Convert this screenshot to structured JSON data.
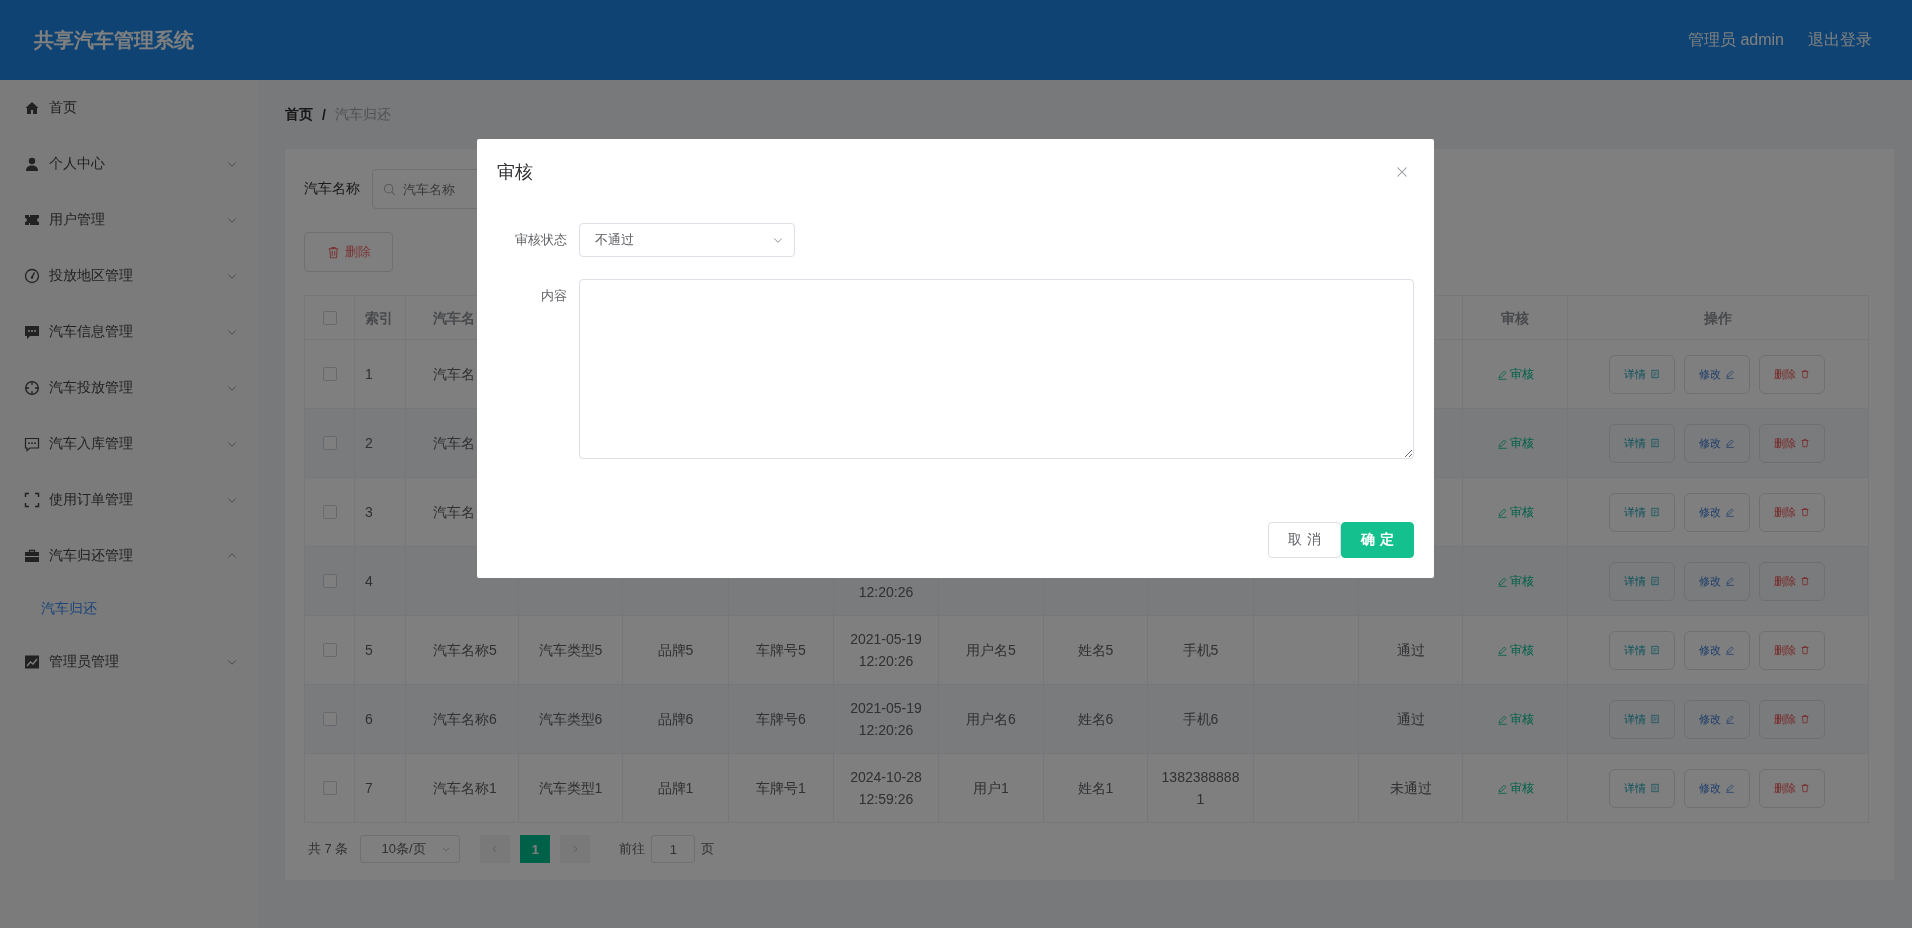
{
  "header": {
    "title": "共享汽车管理系统",
    "user": "管理员 admin",
    "logout": "退出登录"
  },
  "sidebar": {
    "items": [
      {
        "label": "首页",
        "selected": false
      },
      {
        "label": "个人中心",
        "selected": false,
        "expanded": false
      },
      {
        "label": "用户管理",
        "selected": false,
        "expanded": false
      },
      {
        "label": "投放地区管理",
        "selected": false,
        "expanded": false
      },
      {
        "label": "汽车信息管理",
        "selected": false,
        "expanded": false
      },
      {
        "label": "汽车投放管理",
        "selected": false,
        "expanded": false
      },
      {
        "label": "汽车入库管理",
        "selected": false,
        "expanded": false
      },
      {
        "label": "使用订单管理",
        "selected": false,
        "expanded": false
      },
      {
        "label": "汽车归还管理",
        "selected": false,
        "expanded": true,
        "children": [
          {
            "label": "汽车归还",
            "selected": true
          }
        ]
      },
      {
        "label": "管理员管理",
        "selected": false,
        "expanded": false
      }
    ]
  },
  "breadcrumb": {
    "separator": "/",
    "items": [
      {
        "label": "首页",
        "selected": false
      },
      {
        "label": "汽车归还",
        "selected": true
      }
    ]
  },
  "search": {
    "label": "汽车名称",
    "placeholder": "汽车名称"
  },
  "delete_button": "删除",
  "table": {
    "select_all": {
      "checked": false
    },
    "columns": [
      {
        "kind": "index",
        "label": "索引"
      },
      {
        "kind": "name",
        "label": "汽车名"
      },
      {
        "kind": "review",
        "label": "审核"
      },
      {
        "kind": "actions",
        "label": "操作"
      }
    ],
    "rows": [
      {
        "checked": false,
        "index": "1",
        "name": "汽车名",
        "review": "审核",
        "actions": [
          {
            "kind": "detail",
            "label": "详情"
          },
          {
            "kind": "edit",
            "label": "修改"
          },
          {
            "kind": "delete",
            "label": "删除"
          }
        ]
      },
      {
        "checked": false,
        "index": "2",
        "name": "汽车名",
        "review": "审核",
        "actions": [
          {
            "kind": "detail",
            "label": "详情"
          },
          {
            "kind": "edit",
            "label": "修改"
          },
          {
            "kind": "delete",
            "label": "删除"
          }
        ]
      },
      {
        "checked": false,
        "index": "3",
        "name": "汽车名",
        "review": "审核",
        "actions": [
          {
            "kind": "detail",
            "label": "详情"
          },
          {
            "kind": "edit",
            "label": "修改"
          },
          {
            "kind": "delete",
            "label": "删除"
          }
        ]
      },
      {
        "checked": false,
        "index": "4",
        "time": "12:20:26",
        "review": "审核",
        "actions": [
          {
            "kind": "detail",
            "label": "详情"
          },
          {
            "kind": "edit",
            "label": "修改"
          },
          {
            "kind": "delete",
            "label": "删除"
          }
        ]
      },
      {
        "checked": false,
        "index": "5",
        "name": "汽车名称5",
        "type": "汽车类型5",
        "brand": "品牌5",
        "plate": "车牌号5",
        "time": "2021-05-19 12:20:26",
        "user": "用户名5",
        "realname": "姓名5",
        "phone": "手机5",
        "status": "通过",
        "review": "审核",
        "actions": [
          {
            "kind": "detail",
            "label": "详情"
          },
          {
            "kind": "edit",
            "label": "修改"
          },
          {
            "kind": "delete",
            "label": "删除"
          }
        ]
      },
      {
        "checked": false,
        "index": "6",
        "name": "汽车名称6",
        "type": "汽车类型6",
        "brand": "品牌6",
        "plate": "车牌号6",
        "time": "2021-05-19 12:20:26",
        "user": "用户名6",
        "realname": "姓名6",
        "phone": "手机6",
        "status": "通过",
        "review": "审核",
        "actions": [
          {
            "kind": "detail",
            "label": "详情"
          },
          {
            "kind": "edit",
            "label": "修改"
          },
          {
            "kind": "delete",
            "label": "删除"
          }
        ]
      },
      {
        "checked": false,
        "index": "7",
        "name": "汽车名称1",
        "type": "汽车类型1",
        "brand": "品牌1",
        "plate": "车牌号1",
        "time": "2024-10-28 12:59:26",
        "user": "用户1",
        "realname": "姓名1",
        "phone": "13823888881",
        "status": "未通过",
        "review": "审核",
        "actions": [
          {
            "kind": "detail",
            "label": "详情"
          },
          {
            "kind": "edit",
            "label": "修改"
          },
          {
            "kind": "delete",
            "label": "删除"
          }
        ]
      }
    ]
  },
  "pagination": {
    "total": "共 7 条",
    "page_size": "10条/页",
    "pages": [
      {
        "label": "1",
        "selected": true
      }
    ],
    "jump_label": "前往",
    "jump_value": "1",
    "jump_suffix": "页"
  },
  "dialog": {
    "title": "审核",
    "fields": [
      {
        "kind": "select",
        "label": "审核状态",
        "value": "不通过"
      },
      {
        "kind": "textarea",
        "label": "内容"
      }
    ],
    "buttons": [
      {
        "kind": "cancel",
        "label": "取消"
      },
      {
        "kind": "primary",
        "label": "确定"
      }
    ]
  }
}
